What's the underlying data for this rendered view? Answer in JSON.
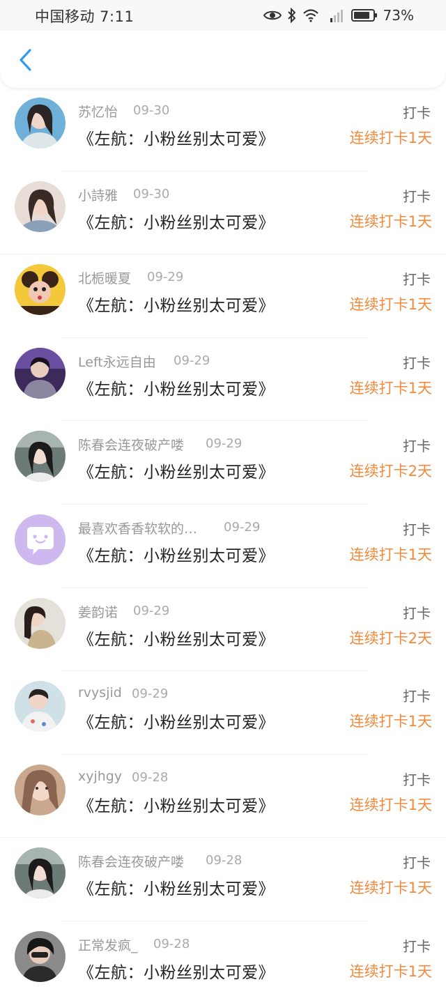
{
  "status_bar": {
    "carrier_time": "中国移动 7:11",
    "network": "4G",
    "battery": "73%"
  },
  "nav": {
    "back_icon": "chevron-left-icon",
    "accent": "#2f9bf0"
  },
  "colors": {
    "streak": "#f08a3c",
    "meta": "#999999",
    "title": "#222222"
  },
  "items": [
    {
      "user": "苏忆怡",
      "date": "09-30",
      "book": "《左航：小粉丝别太可爱》",
      "action": "打卡",
      "streak": "连续打卡1天",
      "avatar": "photo"
    },
    {
      "user": "小詩雅",
      "date": "09-30",
      "book": "《左航：小粉丝别太可爱》",
      "action": "打卡",
      "streak": "连续打卡1天",
      "avatar": "photo"
    },
    {
      "user": "北栀暖夏",
      "date": "09-29",
      "book": "《左航：小粉丝别太可爱》",
      "action": "打卡",
      "streak": "连续打卡1天",
      "avatar": "photo"
    },
    {
      "user": "Left永远自由",
      "date": "09-29",
      "book": "《左航：小粉丝别太可爱》",
      "action": "打卡",
      "streak": "连续打卡1天",
      "avatar": "photo"
    },
    {
      "user": "陈春会连夜破产喽",
      "date": "09-29",
      "book": "《左航：小粉丝别太可爱》",
      "action": "打卡",
      "streak": "连续打卡2天",
      "avatar": "photo"
    },
    {
      "user": "最喜欢香香软软的…",
      "date": "09-29",
      "book": "《左航：小粉丝别太可爱》",
      "action": "打卡",
      "streak": "连续打卡1天",
      "avatar": "default"
    },
    {
      "user": "姜韵诺",
      "date": "09-29",
      "book": "《左航：小粉丝别太可爱》",
      "action": "打卡",
      "streak": "连续打卡2天",
      "avatar": "photo"
    },
    {
      "user": "rvysjid",
      "date": "09-29",
      "book": "《左航：小粉丝别太可爱》",
      "action": "打卡",
      "streak": "连续打卡1天",
      "avatar": "photo"
    },
    {
      "user": "xyjhgy",
      "date": "09-28",
      "book": "《左航：小粉丝别太可爱》",
      "action": "打卡",
      "streak": "连续打卡1天",
      "avatar": "photo"
    },
    {
      "user": "陈春会连夜破产喽",
      "date": "09-28",
      "book": "《左航：小粉丝别太可爱》",
      "action": "打卡",
      "streak": "连续打卡1天",
      "avatar": "photo"
    },
    {
      "user": "正常发疯_",
      "date": "09-28",
      "book": "《左航：小粉丝别太可爱》",
      "action": "打卡",
      "streak": "连续打卡1天",
      "avatar": "photo"
    }
  ]
}
